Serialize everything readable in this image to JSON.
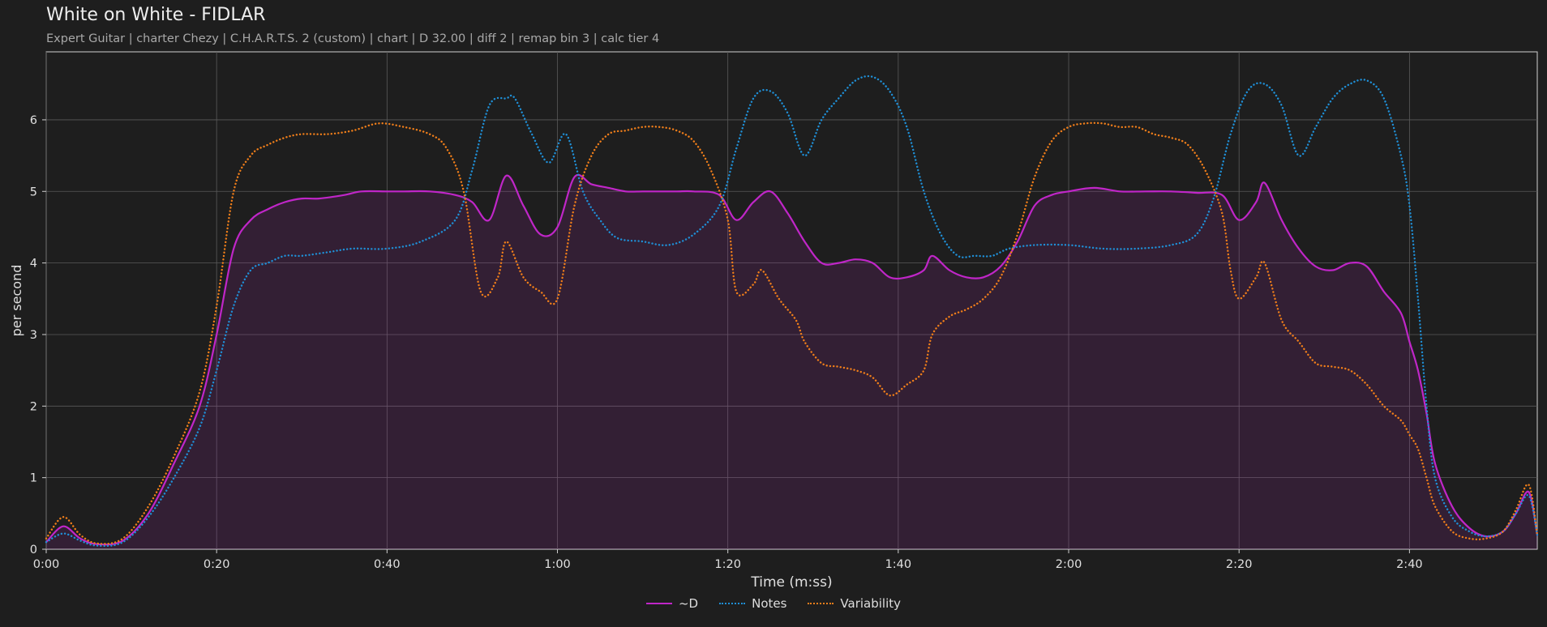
{
  "chart_data": {
    "type": "line",
    "title": "White on White - FIDLAR",
    "subtitle": "Expert Guitar  |  charter Chezy  |  C.H.A.R.T.S. 2 (custom)  |  chart  |  D 32.00  |  diff 2  |  remap bin 3  |  calc tier 4",
    "xlabel": "Time (m:ss)",
    "ylabel": "per second",
    "xlim": [
      0,
      175
    ],
    "ylim": [
      0,
      6.95
    ],
    "x_ticks": [
      0,
      20,
      40,
      60,
      80,
      100,
      120,
      140,
      160
    ],
    "x_tick_labels": [
      "0:00",
      "0:20",
      "0:40",
      "1:00",
      "1:20",
      "1:40",
      "2:00",
      "2:20",
      "2:40"
    ],
    "y_ticks": [
      0,
      1,
      2,
      3,
      4,
      5,
      6
    ],
    "y_tick_labels": [
      "0",
      "1",
      "2",
      "3",
      "4",
      "5",
      "6"
    ],
    "grid": true,
    "legend_position": "bottom-center",
    "series": [
      {
        "name": "~D",
        "color": "#c026c8",
        "style": "solid",
        "fill": true,
        "points": [
          [
            0,
            0.1
          ],
          [
            2,
            0.32
          ],
          [
            4,
            0.15
          ],
          [
            6,
            0.07
          ],
          [
            9,
            0.12
          ],
          [
            12,
            0.5
          ],
          [
            15,
            1.2
          ],
          [
            18,
            2.0
          ],
          [
            20,
            3.0
          ],
          [
            22,
            4.2
          ],
          [
            24,
            4.6
          ],
          [
            26,
            4.75
          ],
          [
            28,
            4.85
          ],
          [
            30,
            4.9
          ],
          [
            32,
            4.9
          ],
          [
            35,
            4.95
          ],
          [
            37,
            5.0
          ],
          [
            40,
            5.0
          ],
          [
            42,
            5.0
          ],
          [
            45,
            5.0
          ],
          [
            48,
            4.95
          ],
          [
            50,
            4.85
          ],
          [
            52,
            4.6
          ],
          [
            54,
            5.22
          ],
          [
            56,
            4.8
          ],
          [
            58,
            4.4
          ],
          [
            60,
            4.5
          ],
          [
            62,
            5.2
          ],
          [
            64,
            5.1
          ],
          [
            66,
            5.05
          ],
          [
            68,
            5.0
          ],
          [
            70,
            5.0
          ],
          [
            72,
            5.0
          ],
          [
            74,
            5.0
          ],
          [
            76,
            5.0
          ],
          [
            79,
            4.95
          ],
          [
            81,
            4.6
          ],
          [
            83,
            4.85
          ],
          [
            85,
            5.0
          ],
          [
            87,
            4.7
          ],
          [
            89,
            4.3
          ],
          [
            91,
            4.0
          ],
          [
            93,
            4.0
          ],
          [
            95,
            4.05
          ],
          [
            97,
            4.0
          ],
          [
            99,
            3.8
          ],
          [
            101,
            3.8
          ],
          [
            103,
            3.9
          ],
          [
            104,
            4.1
          ],
          [
            106,
            3.9
          ],
          [
            108,
            3.8
          ],
          [
            110,
            3.8
          ],
          [
            112,
            3.95
          ],
          [
            114,
            4.3
          ],
          [
            116,
            4.8
          ],
          [
            118,
            4.95
          ],
          [
            120,
            5.0
          ],
          [
            123,
            5.05
          ],
          [
            126,
            5.0
          ],
          [
            129,
            5.0
          ],
          [
            132,
            5.0
          ],
          [
            135,
            4.98
          ],
          [
            138,
            4.95
          ],
          [
            140,
            4.6
          ],
          [
            142,
            4.85
          ],
          [
            143,
            5.12
          ],
          [
            145,
            4.6
          ],
          [
            147,
            4.2
          ],
          [
            149,
            3.95
          ],
          [
            151,
            3.9
          ],
          [
            153,
            4.0
          ],
          [
            155,
            3.95
          ],
          [
            157,
            3.6
          ],
          [
            159,
            3.3
          ],
          [
            160,
            2.9
          ],
          [
            161,
            2.5
          ],
          [
            162,
            1.9
          ],
          [
            163,
            1.2
          ],
          [
            165,
            0.6
          ],
          [
            167,
            0.3
          ],
          [
            169,
            0.18
          ],
          [
            171,
            0.25
          ],
          [
            172.5,
            0.5
          ],
          [
            174,
            0.8
          ],
          [
            175,
            0.2
          ]
        ]
      },
      {
        "name": "Notes",
        "color": "#1f8fd6",
        "style": "dotted",
        "fill": false,
        "points": [
          [
            0,
            0.1
          ],
          [
            2,
            0.22
          ],
          [
            4,
            0.12
          ],
          [
            6,
            0.05
          ],
          [
            9,
            0.1
          ],
          [
            12,
            0.45
          ],
          [
            15,
            1.0
          ],
          [
            18,
            1.7
          ],
          [
            20,
            2.5
          ],
          [
            22,
            3.4
          ],
          [
            24,
            3.9
          ],
          [
            26,
            4.0
          ],
          [
            28,
            4.1
          ],
          [
            30,
            4.1
          ],
          [
            33,
            4.15
          ],
          [
            36,
            4.2
          ],
          [
            40,
            4.2
          ],
          [
            44,
            4.3
          ],
          [
            48,
            4.6
          ],
          [
            50,
            5.3
          ],
          [
            52,
            6.2
          ],
          [
            54,
            6.3
          ],
          [
            55,
            6.3
          ],
          [
            57,
            5.8
          ],
          [
            59,
            5.4
          ],
          [
            61,
            5.8
          ],
          [
            63,
            5.0
          ],
          [
            65,
            4.6
          ],
          [
            67,
            4.35
          ],
          [
            70,
            4.3
          ],
          [
            73,
            4.25
          ],
          [
            76,
            4.4
          ],
          [
            79,
            4.8
          ],
          [
            81,
            5.6
          ],
          [
            83,
            6.3
          ],
          [
            85,
            6.4
          ],
          [
            87,
            6.1
          ],
          [
            89,
            5.5
          ],
          [
            91,
            6.0
          ],
          [
            93,
            6.3
          ],
          [
            95,
            6.55
          ],
          [
            97,
            6.6
          ],
          [
            99,
            6.4
          ],
          [
            101,
            5.9
          ],
          [
            103,
            5.0
          ],
          [
            105,
            4.4
          ],
          [
            107,
            4.1
          ],
          [
            109,
            4.1
          ],
          [
            111,
            4.1
          ],
          [
            113,
            4.2
          ],
          [
            116,
            4.25
          ],
          [
            120,
            4.25
          ],
          [
            124,
            4.2
          ],
          [
            128,
            4.2
          ],
          [
            132,
            4.25
          ],
          [
            135,
            4.4
          ],
          [
            137,
            4.9
          ],
          [
            139,
            5.8
          ],
          [
            141,
            6.4
          ],
          [
            143,
            6.5
          ],
          [
            145,
            6.2
          ],
          [
            147,
            5.5
          ],
          [
            149,
            5.9
          ],
          [
            151,
            6.3
          ],
          [
            153,
            6.5
          ],
          [
            155,
            6.55
          ],
          [
            157,
            6.3
          ],
          [
            159,
            5.5
          ],
          [
            160,
            4.8
          ],
          [
            161,
            3.5
          ],
          [
            162,
            2.0
          ],
          [
            163,
            1.0
          ],
          [
            165,
            0.45
          ],
          [
            167,
            0.25
          ],
          [
            169,
            0.18
          ],
          [
            171,
            0.25
          ],
          [
            172.5,
            0.5
          ],
          [
            174,
            0.75
          ],
          [
            175,
            0.2
          ]
        ]
      },
      {
        "name": "Variability",
        "color": "#f07e1a",
        "style": "dotted",
        "fill": false,
        "points": [
          [
            0,
            0.15
          ],
          [
            2,
            0.45
          ],
          [
            4,
            0.2
          ],
          [
            6,
            0.08
          ],
          [
            9,
            0.15
          ],
          [
            12,
            0.6
          ],
          [
            15,
            1.3
          ],
          [
            18,
            2.2
          ],
          [
            20,
            3.4
          ],
          [
            22,
            5.0
          ],
          [
            24,
            5.5
          ],
          [
            26,
            5.65
          ],
          [
            28,
            5.75
          ],
          [
            30,
            5.8
          ],
          [
            33,
            5.8
          ],
          [
            36,
            5.85
          ],
          [
            39,
            5.95
          ],
          [
            42,
            5.9
          ],
          [
            45,
            5.8
          ],
          [
            47,
            5.6
          ],
          [
            49,
            5.0
          ],
          [
            51,
            3.6
          ],
          [
            53,
            3.8
          ],
          [
            54,
            4.3
          ],
          [
            56,
            3.8
          ],
          [
            58,
            3.6
          ],
          [
            60,
            3.5
          ],
          [
            62,
            4.8
          ],
          [
            64,
            5.5
          ],
          [
            66,
            5.8
          ],
          [
            68,
            5.85
          ],
          [
            70,
            5.9
          ],
          [
            72,
            5.9
          ],
          [
            74,
            5.85
          ],
          [
            76,
            5.7
          ],
          [
            78,
            5.3
          ],
          [
            80,
            4.6
          ],
          [
            81,
            3.6
          ],
          [
            83,
            3.7
          ],
          [
            84,
            3.9
          ],
          [
            86,
            3.5
          ],
          [
            88,
            3.2
          ],
          [
            89,
            2.9
          ],
          [
            91,
            2.6
          ],
          [
            93,
            2.55
          ],
          [
            95,
            2.5
          ],
          [
            97,
            2.4
          ],
          [
            99,
            2.15
          ],
          [
            101,
            2.3
          ],
          [
            103,
            2.5
          ],
          [
            104,
            3.0
          ],
          [
            106,
            3.25
          ],
          [
            108,
            3.35
          ],
          [
            110,
            3.5
          ],
          [
            112,
            3.8
          ],
          [
            114,
            4.4
          ],
          [
            116,
            5.2
          ],
          [
            118,
            5.7
          ],
          [
            120,
            5.9
          ],
          [
            122,
            5.95
          ],
          [
            124,
            5.95
          ],
          [
            126,
            5.9
          ],
          [
            128,
            5.9
          ],
          [
            130,
            5.8
          ],
          [
            132,
            5.75
          ],
          [
            134,
            5.65
          ],
          [
            136,
            5.3
          ],
          [
            138,
            4.7
          ],
          [
            139,
            3.9
          ],
          [
            140,
            3.5
          ],
          [
            142,
            3.8
          ],
          [
            143,
            4.0
          ],
          [
            145,
            3.2
          ],
          [
            147,
            2.9
          ],
          [
            149,
            2.6
          ],
          [
            151,
            2.55
          ],
          [
            153,
            2.5
          ],
          [
            155,
            2.3
          ],
          [
            157,
            2.0
          ],
          [
            159,
            1.8
          ],
          [
            160,
            1.6
          ],
          [
            161,
            1.4
          ],
          [
            162,
            1.0
          ],
          [
            163,
            0.6
          ],
          [
            165,
            0.25
          ],
          [
            167,
            0.15
          ],
          [
            169,
            0.15
          ],
          [
            171,
            0.25
          ],
          [
            172.5,
            0.55
          ],
          [
            174,
            0.9
          ],
          [
            175,
            0.2
          ]
        ]
      }
    ]
  }
}
